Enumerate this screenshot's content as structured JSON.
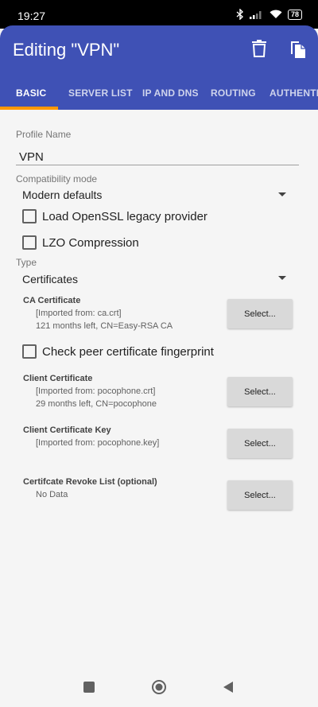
{
  "status_bar": {
    "time": "19:27",
    "battery": "78",
    "icons": [
      "bluetooth-icon",
      "signal-icon",
      "wifi-icon",
      "battery-icon"
    ]
  },
  "app_bar": {
    "title": "Editing \"VPN\"",
    "actions": [
      "delete-icon",
      "copy-icon"
    ],
    "color": "#3f51b5"
  },
  "tabs": [
    {
      "label": "BASIC",
      "active": true
    },
    {
      "label": "SERVER LIST",
      "active": false
    },
    {
      "label": "IP AND DNS",
      "active": false
    },
    {
      "label": "ROUTING",
      "active": false
    },
    {
      "label": "AUTHENTIC",
      "active": false
    }
  ],
  "accent_color": "#ff9800",
  "form": {
    "profile_name_label": "Profile Name",
    "profile_name_value": "VPN",
    "compat_label": "Compatibility mode",
    "compat_value": "Modern defaults",
    "legacy_provider_label": "Load OpenSSL legacy provider",
    "lzo_label": "LZO Compression",
    "type_label": "Type",
    "type_value": "Certificates",
    "ca": {
      "title": "CA Certificate",
      "line1": "[Imported from: ca.crt]",
      "line2": "121 months left, CN=Easy-RSA CA",
      "button": "Select..."
    },
    "peer_fingerprint_label": "Check peer certificate fingerprint",
    "client_cert": {
      "title": "Client Certificate",
      "line1": "[Imported from: pocophone.crt]",
      "line2": "29 months left, CN=pocophone",
      "button": "Select..."
    },
    "client_key": {
      "title": "Client Certificate Key",
      "line1": "[Imported from: pocophone.key]",
      "button": "Select..."
    },
    "crl": {
      "title": "Certifcate Revoke List (optional)",
      "line1": "No Data",
      "button": "Select..."
    }
  },
  "nav_bar": [
    "recents-square-icon",
    "home-circle-icon",
    "back-triangle-icon"
  ]
}
